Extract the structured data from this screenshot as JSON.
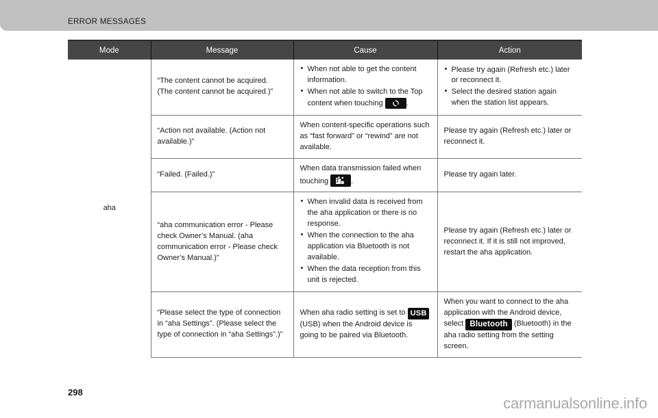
{
  "header": {
    "banner_title": "ERROR MESSAGES",
    "banner_color": "#c0c0c0"
  },
  "table": {
    "header_bg": "#464646",
    "columns": [
      "Mode",
      "Message",
      "Cause",
      "Action"
    ],
    "mode_label": "aha",
    "rows": [
      {
        "message": "“The content cannot be acquired.\n(The content cannot be acquired.)”",
        "message_lines": [
          "“The content cannot be acquired.",
          "(The content cannot be acquired.)”"
        ],
        "cause_bullets": [
          "When not able to get the content information.",
          "When not able to switch to the Top content when touching"
        ],
        "cause_icon": "refresh-icon",
        "cause_icon_suffix": ".",
        "action_bullets": [
          "Please try again (Refresh etc.) later or reconnect it.",
          "Select the desired station again when the station list appears."
        ]
      },
      {
        "message": "“Action not available. (Action not available.)”",
        "cause": "When content-specific operations such as “fast forward” or “rewind” are not available.",
        "action": "Please try again (Refresh etc.) later or reconnect it."
      },
      {
        "message": "“Failed. (Failed.)”",
        "cause_pre": "When data transmission failed when touching",
        "cause_icon": "photo-share-icon",
        "cause_post": ".",
        "action": "Please try again later."
      },
      {
        "message": "“aha communication error - Please check Owner’s Manual. (aha communication error - Please check Owner’s Manual.)”",
        "cause_bullets": [
          "When invalid data is received from the aha application or there is no response.",
          "When the connection to the aha application via Bluetooth is not available.",
          "When the data reception from this unit is rejected."
        ],
        "action": "Please try again (Refresh etc.) later or reconnect it. If it is still not improved, restart the aha application."
      },
      {
        "message": "“Please select the type of connection in “aha Settings”. (Please select the type of connection in “aha Settings”.)”",
        "cause_pre": "When aha radio setting is set to",
        "cause_badge": "USB",
        "cause_post": "(USB) when the Android device is going to be paired via Bluetooth.",
        "action_pre": "When you want to connect to the aha application with the Android device, select",
        "action_badge": "Bluetooth",
        "action_post": "(Bluetooth) in the aha radio setting from the setting screen."
      }
    ]
  },
  "footer": {
    "page_number": "298",
    "watermark": "carmanualsonline.info"
  }
}
